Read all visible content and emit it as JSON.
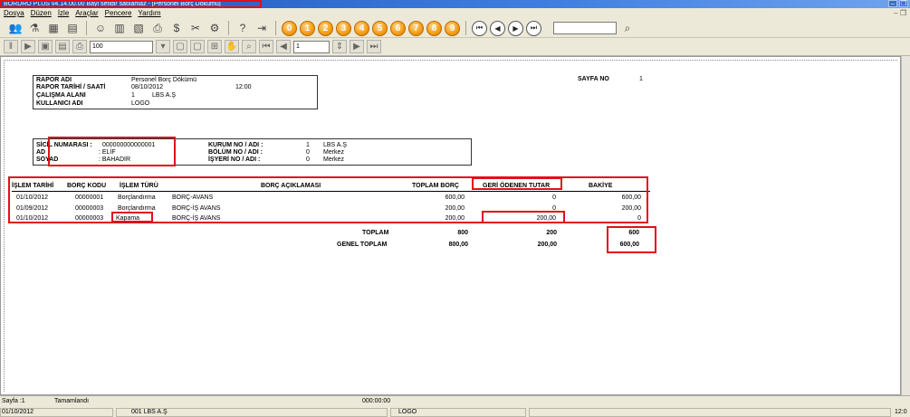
{
  "window": {
    "title": "BORDRO PLUS v4.14.00.00 Bayi setidir satılamaz - [Personel Borç Dökümü]",
    "minimize": "–",
    "restore": "❐"
  },
  "menu": [
    "Dosya",
    "Düzen",
    "İzle",
    "Araçlar",
    "Pencere",
    "Yardım"
  ],
  "mdi_controls": "– ❐",
  "toolbar2": {
    "zoom": "100",
    "page": "1"
  },
  "report": {
    "header": {
      "rapor_adi_label": "RAPOR ADI",
      "rapor_adi": "Personel Borç Dökümü",
      "tarih_label": "RAPOR TARİHİ / SAATİ",
      "tarih": "08/10/2012",
      "saat": "12:00",
      "calisma_label": "ÇALIŞMA ALANI",
      "calisma_no": "1",
      "calisma_ad": "LBS A.Ş",
      "kullanici_label": "KULLANICI ADI",
      "kullanici": "LOGO",
      "sayfa_label": "SAYFA NO",
      "sayfa_no": "1"
    },
    "personel": {
      "sicil_label": "SİCİL NUMARASI :",
      "sicil": "000000000000001",
      "ad_label": "AD",
      "ad": ": ELİF",
      "soyad_label": "SOYAD",
      "soyad": ": BAHADIR",
      "kurum_label": "KURUM NO  / ADI :",
      "kurum_no": "1",
      "kurum_ad": "LBS A.Ş",
      "bolum_label": "BÖLÜM NO / ADI :",
      "bolum_no": "0",
      "bolum_ad": "Merkez",
      "isyeri_label": "İŞYERİ NO  / ADI :",
      "isyeri_no": "0",
      "isyeri_ad": "Merkez"
    },
    "columns": [
      "İŞLEM TARİHİ",
      "BORÇ KODU",
      "İŞLEM TÜRÜ",
      "BORÇ AÇIKLAMASI",
      "TOPLAM BORÇ",
      "GERİ ÖDENEN TUTAR",
      "BAKİYE"
    ],
    "rows": [
      {
        "tarih": "01/10/2012",
        "kod": "00000001",
        "tur": "Borçlandırma",
        "aciklama": "BORÇ-AVANS",
        "toplam": "600,00",
        "odenen": "0",
        "bakiye": "600,00"
      },
      {
        "tarih": "01/09/2012",
        "kod": "00000003",
        "tur": "Borçlandırma",
        "aciklama": "BORÇ-İŞ AVANS",
        "toplam": "200,00",
        "odenen": "0",
        "bakiye": "200,00"
      },
      {
        "tarih": "01/10/2012",
        "kod": "00000003",
        "tur": "Kapama",
        "aciklama": "BORÇ-İŞ AVANS",
        "toplam": "200,00",
        "odenen": "200,00",
        "bakiye": "0"
      }
    ],
    "totals": {
      "toplam_label": "TOPLAM",
      "toplam_borc": "800",
      "toplam_odenen": "200",
      "toplam_bakiye": "600",
      "genel_label": "GENEL TOPLAM",
      "genel_borc": "800,00",
      "genel_odenen": "200,00",
      "genel_bakiye": "600,00"
    }
  },
  "status": {
    "sayfa": "Sayfa :1",
    "durum": "Tamamlandı",
    "zaman": "000:00:00",
    "tarih": "01/10/2012",
    "firma": "001 LBS A.Ş",
    "kullanici": "LOGO",
    "saat": "12:0"
  },
  "colors": {
    "highlight": "#e0101b",
    "titlebar": "#1d54b5",
    "accent_button": "#f39c12"
  }
}
